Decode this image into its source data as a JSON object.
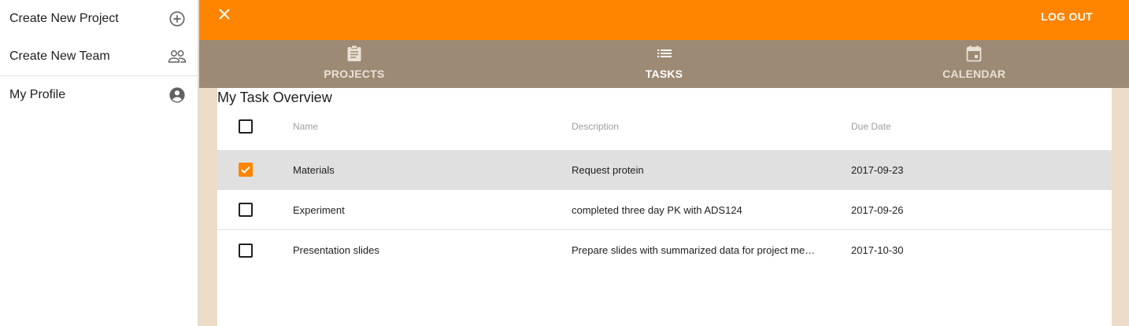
{
  "sidebar": {
    "items": [
      {
        "label": "Create New Project",
        "icon": "add-circle-icon"
      },
      {
        "label": "Create New Team",
        "icon": "people-icon"
      },
      {
        "label": "My Profile",
        "icon": "account-circle-icon"
      }
    ]
  },
  "appbar": {
    "close_icon": "close-icon",
    "logout_label": "LOG OUT",
    "color": "#ff8400"
  },
  "tabs": [
    {
      "label": "PROJECTS",
      "icon": "clipboard-icon",
      "active": false
    },
    {
      "label": "TASKS",
      "icon": "list-icon",
      "active": true
    },
    {
      "label": "CALENDAR",
      "icon": "calendar-icon",
      "active": false
    }
  ],
  "colors": {
    "accent": "#ff8400",
    "tab_bar": "#9c8a74",
    "page_bg": "#ecdcc8",
    "selected_row": "#e0e0e0"
  },
  "overview": {
    "title": "My Task Overview",
    "columns": {
      "name": "Name",
      "description": "Description",
      "due_date": "Due Date"
    },
    "header_checked": false,
    "rows": [
      {
        "name": "Materials",
        "description": "Request protein",
        "due_date": "2017-09-23",
        "checked": true
      },
      {
        "name": "Experiment",
        "description": "completed three day PK with ADS124",
        "due_date": "2017-09-26",
        "checked": false
      },
      {
        "name": "Presentation slides",
        "description": "Prepare slides with summarized data for project me…",
        "due_date": "2017-10-30",
        "checked": false
      }
    ]
  }
}
